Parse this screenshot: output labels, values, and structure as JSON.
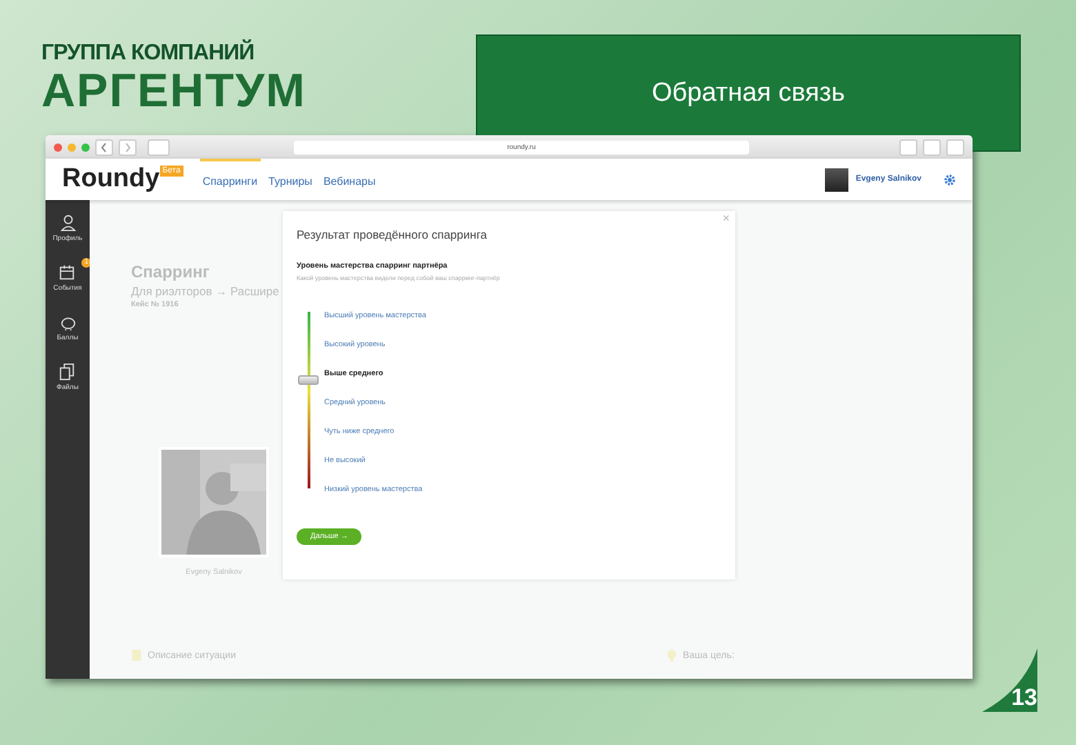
{
  "slide": {
    "logo_caption": "ГРУППА КОМПАНИЙ",
    "logo_name": "АРГЕНТУМ",
    "title": "Обратная связь",
    "page_number": "13"
  },
  "browser": {
    "url": "roundy.ru"
  },
  "header": {
    "logo": "Roundy",
    "badge": "Бета",
    "user": "Evgeny Salnikov",
    "nav": [
      {
        "label": "Спарринги",
        "selected": true
      },
      {
        "label": "Турниры",
        "selected": false
      },
      {
        "label": "Вебинары",
        "selected": false
      }
    ]
  },
  "sidebar": {
    "items": [
      {
        "label": "Профиль",
        "kind": "person"
      },
      {
        "label": "События",
        "kind": "calendar",
        "badge": "1"
      },
      {
        "label": "Баллы",
        "kind": "piggy"
      },
      {
        "label": "Файлы",
        "kind": "files"
      }
    ]
  },
  "page": {
    "title": "Спарринг",
    "subtitle": "Для риэлторов → Расшире",
    "case": "Кейс № 1916",
    "photo_caption": "Evgeny Salnikov",
    "section_left": "Описание ситуации",
    "section_right": "Ваша цель:"
  },
  "modal": {
    "title": "Результат проведённого спарринга",
    "question": "Уровень мастерства спарринг партнёра",
    "hint": "Какой уровень мастерства видели перед собой ваш спарринг-партнёр",
    "levels": [
      {
        "label": "Высший уровень мастерства",
        "selected": false
      },
      {
        "label": "Высокий уровень",
        "selected": false
      },
      {
        "label": "Выше среднего",
        "selected": true
      },
      {
        "label": "Средний уровень",
        "selected": false
      },
      {
        "label": "Чуть ниже среднего",
        "selected": false
      },
      {
        "label": "Не высокий",
        "selected": false
      },
      {
        "label": "Низкий уровень мастерства",
        "selected": false
      }
    ],
    "button": "Дальше →",
    "close": "×"
  }
}
